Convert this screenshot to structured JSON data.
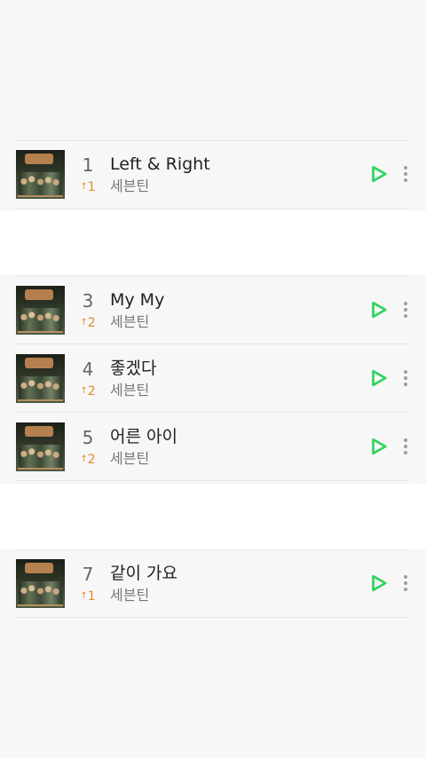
{
  "colors": {
    "background": "#f7f7f7",
    "gap_background": "#ffffff",
    "play_accent": "#2fd45f",
    "rank_change": "#e68a2e",
    "divider": "#e7e7e7"
  },
  "icons": {
    "album_art": "album-cover",
    "play": "play-icon",
    "more": "more-vertical-icon",
    "change": "arrow-up-icon"
  },
  "list": {
    "items": [
      {
        "rank": "1",
        "change": "1",
        "title": "Left & Right",
        "artist": "세븐틴"
      },
      {
        "rank": "3",
        "change": "2",
        "title": "My My",
        "artist": "세븐틴"
      },
      {
        "rank": "4",
        "change": "2",
        "title": "좋겠다",
        "artist": "세븐틴"
      },
      {
        "rank": "5",
        "change": "2",
        "title": "어른 아이",
        "artist": "세븐틴"
      },
      {
        "rank": "7",
        "change": "1",
        "title": "같이 가요",
        "artist": "세븐틴"
      }
    ]
  }
}
